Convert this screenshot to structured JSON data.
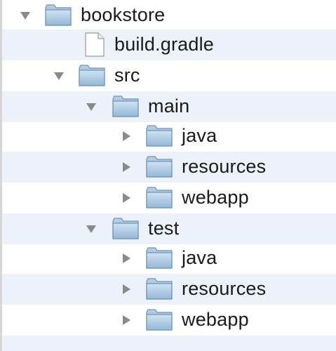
{
  "file_tree": {
    "items": [
      {
        "label": "bookstore",
        "type": "folder",
        "state": "expanded",
        "depth": 0
      },
      {
        "label": "build.gradle",
        "type": "file",
        "state": "none",
        "depth": 1
      },
      {
        "label": "src",
        "type": "folder",
        "state": "expanded",
        "depth": 1
      },
      {
        "label": "main",
        "type": "folder",
        "state": "expanded",
        "depth": 2
      },
      {
        "label": "java",
        "type": "folder",
        "state": "collapsed",
        "depth": 3
      },
      {
        "label": "resources",
        "type": "folder",
        "state": "collapsed",
        "depth": 3
      },
      {
        "label": "webapp",
        "type": "folder",
        "state": "collapsed",
        "depth": 3
      },
      {
        "label": "test",
        "type": "folder",
        "state": "expanded",
        "depth": 2
      },
      {
        "label": "java",
        "type": "folder",
        "state": "collapsed",
        "depth": 3
      },
      {
        "label": "resources",
        "type": "folder",
        "state": "collapsed",
        "depth": 3
      },
      {
        "label": "webapp",
        "type": "folder",
        "state": "collapsed",
        "depth": 3
      }
    ],
    "icons": {
      "folder": "folder-icon",
      "file": "document-icon",
      "expanded": "disclosure-triangle-down-icon",
      "collapsed": "disclosure-triangle-right-icon"
    },
    "colors": {
      "alternate_row": "#edf2fa",
      "folder_body": "#a9c8e3",
      "folder_outline": "#6f93b3",
      "disclosure": "#8a8a8a",
      "text": "#1a1a1a"
    }
  }
}
